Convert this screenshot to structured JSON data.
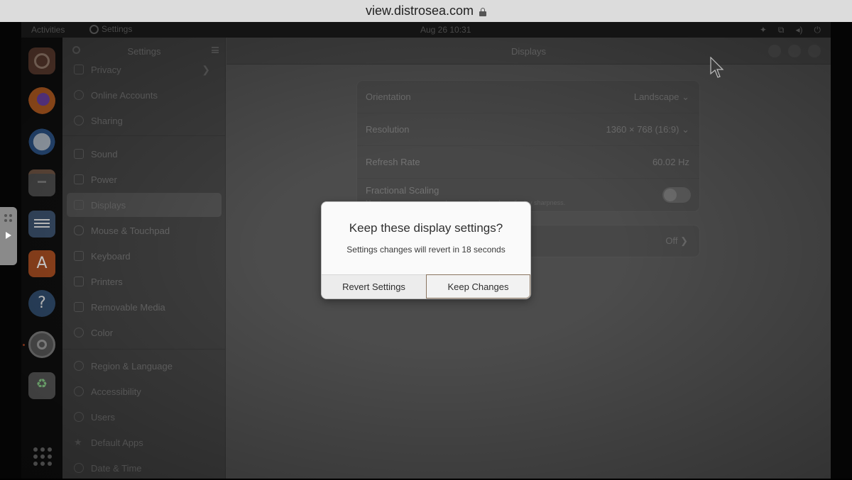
{
  "browser": {
    "url": "view.distrosea.com"
  },
  "topbar": {
    "activities": "Activities",
    "app_name": "Settings",
    "clock": "Aug 26  10:31"
  },
  "dock": {
    "items": [
      "ubuntu-icon",
      "firefox-icon",
      "thunderbird-icon",
      "files-icon",
      "libreoffice-writer-icon",
      "app-center-icon",
      "help-icon",
      "settings-icon",
      "trash-icon",
      "show-apps-icon"
    ]
  },
  "sidebar": {
    "title": "Settings",
    "items": [
      {
        "label": "Privacy",
        "icon": "privacy-icon"
      },
      {
        "label": "Online Accounts",
        "icon": "cloud-icon"
      },
      {
        "label": "Sharing",
        "icon": "share-icon"
      },
      {
        "label": "Sound",
        "icon": "music-note-icon"
      },
      {
        "label": "Power",
        "icon": "power-icon"
      },
      {
        "label": "Displays",
        "icon": "monitor-icon"
      },
      {
        "label": "Mouse & Touchpad",
        "icon": "mouse-icon"
      },
      {
        "label": "Keyboard",
        "icon": "keyboard-icon"
      },
      {
        "label": "Printers",
        "icon": "printer-icon"
      },
      {
        "label": "Removable Media",
        "icon": "usb-icon"
      },
      {
        "label": "Color",
        "icon": "palette-icon"
      },
      {
        "label": "Region & Language",
        "icon": "globe-icon"
      },
      {
        "label": "Accessibility",
        "icon": "accessibility-icon"
      },
      {
        "label": "Users",
        "icon": "users-icon"
      },
      {
        "label": "Default Apps",
        "icon": "star-icon"
      },
      {
        "label": "Date & Time",
        "icon": "clock-icon"
      }
    ]
  },
  "main": {
    "title": "Displays",
    "rows": [
      {
        "label": "Orientation",
        "value": "Landscape"
      },
      {
        "label": "Resolution",
        "value": "1360 × 768 (16:9)"
      },
      {
        "label": "Refresh Rate",
        "value": "60.02 Hz"
      },
      {
        "label": "Fractional Scaling",
        "sub": "May increase power usage, lower speed, or reduce display sharpness."
      }
    ],
    "night_light_value": "Off"
  },
  "dialog": {
    "heading": "Keep these display settings?",
    "body": "Settings changes will revert in 18 seconds",
    "revert_label": "Revert Settings",
    "keep_label": "Keep Changes"
  }
}
